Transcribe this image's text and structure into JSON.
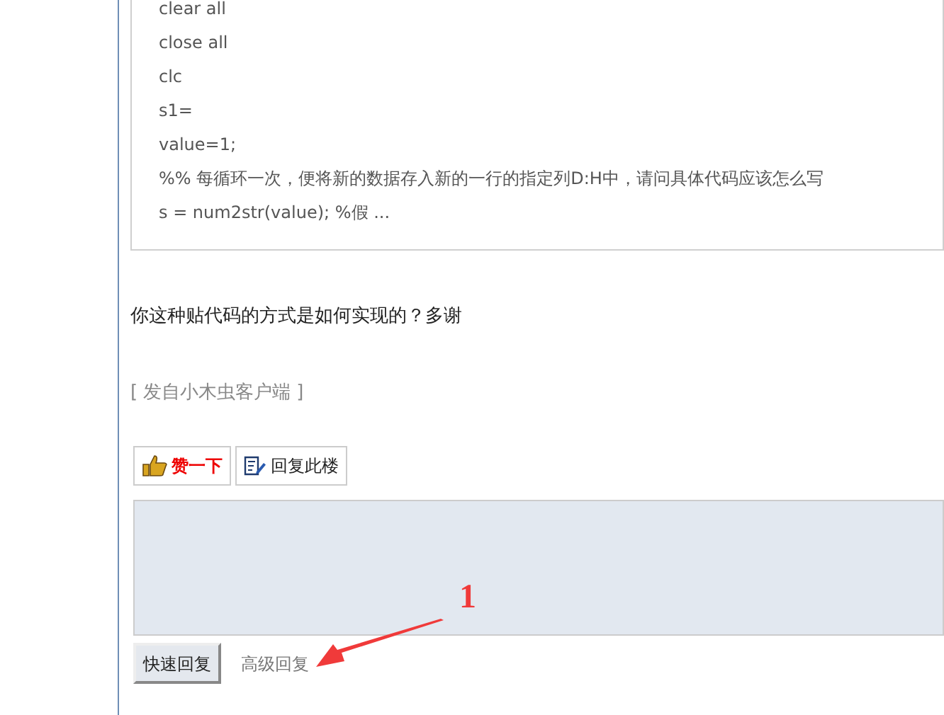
{
  "quote": {
    "lines": [
      "clear all",
      "close all",
      "clc",
      "s1=",
      "value=1;",
      "%% 每循环一次，便将新的数据存入新的一行的指定列D:H中，请问具体代码应该怎么写",
      "s = num2str(value); %假 ..."
    ]
  },
  "message": "你这种贴代码的方式是如何实现的？多谢",
  "source": {
    "open": "[",
    "text": "发自小木虫客户端",
    "close": "]"
  },
  "actions": [
    {
      "kind": "like",
      "label": "赞一下"
    },
    {
      "kind": "reply",
      "label": "回复此楼"
    }
  ],
  "reply_box": {
    "submit": "快速回复",
    "advanced": "高级回复"
  },
  "annotation": {
    "label": "1"
  }
}
